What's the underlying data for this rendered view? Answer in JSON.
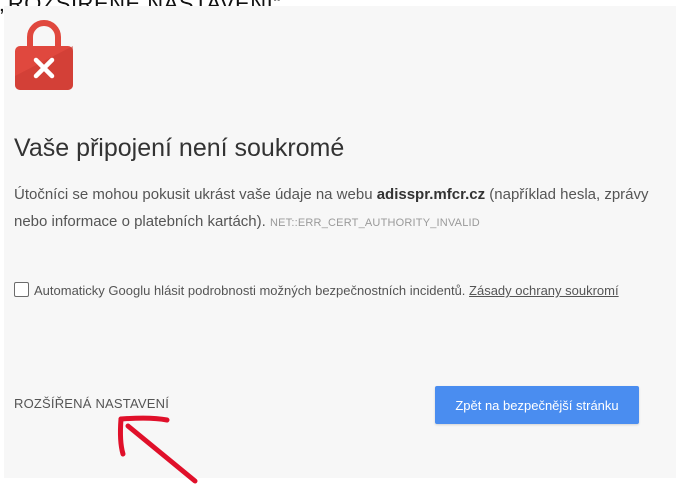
{
  "caption": "„ROZŠÍŘENÉ NASTAVENÍ“",
  "heading": "Vaše připojení není soukromé",
  "description": {
    "prefix": "Útočníci se mohou pokusit ukrást vaše údaje na webu ",
    "domain": "adisspr.mfcr.cz",
    "suffix": " (například hesla, zprávy nebo informace o platebních kartách). ",
    "error_code": "NET::ERR_CERT_AUTHORITY_INVALID"
  },
  "report": {
    "checked": false,
    "label": "Automaticky Googlu hlásit podrobnosti možných bezpečnostních incidentů. ",
    "link": "Zásady ochrany soukromí"
  },
  "advanced_label": "ROZŠÍŘENÁ NASTAVENÍ",
  "back_button_label": "Zpět na bezpečnější stránku",
  "colors": {
    "lock_red": "#e0483e",
    "button_blue": "#4a8df0",
    "arrow_red": "#e0102a",
    "text": "#555555"
  },
  "icons": {
    "lock": "lock-error-icon",
    "arrow": "hand-drawn-arrow"
  }
}
